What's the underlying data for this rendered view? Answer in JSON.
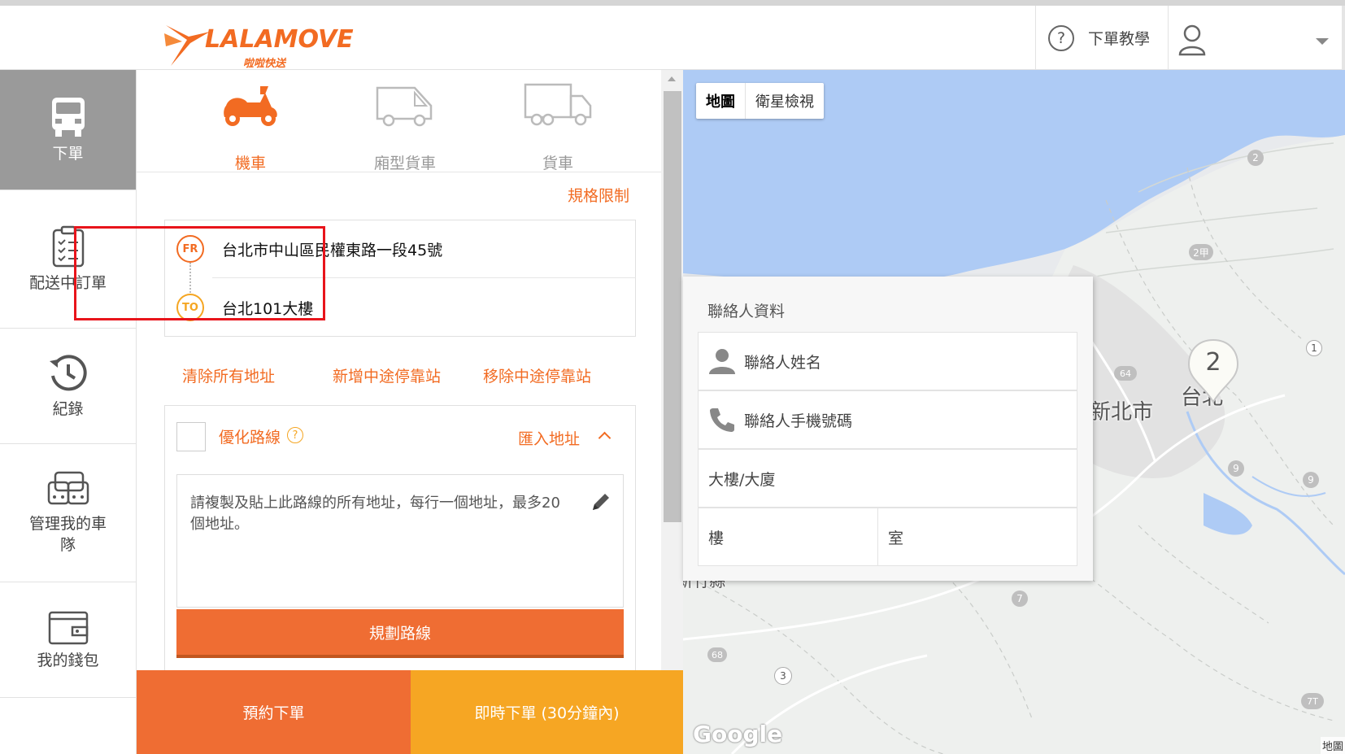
{
  "header": {
    "logo_text": "LALAMOVE",
    "logo_subtext": "啦啦快送",
    "help_icon_glyph": "?",
    "help_label": "下單教學",
    "brand_color": "#f26b22"
  },
  "nav": {
    "items": [
      {
        "label": "下單",
        "icon": "truck-front-icon",
        "active": true
      },
      {
        "label": "配送中訂單",
        "icon": "clipboard-icon",
        "active": false
      },
      {
        "label": "紀錄",
        "icon": "history-icon",
        "active": false
      },
      {
        "label": "管理我的車隊",
        "icon": "fleet-icon",
        "active": false
      },
      {
        "label": "我的錢包",
        "icon": "wallet-icon",
        "active": false
      }
    ]
  },
  "vehicles": [
    {
      "label": "機車",
      "icon": "scooter-icon",
      "active": true
    },
    {
      "label": "廂型貨車",
      "icon": "van-icon",
      "active": false
    },
    {
      "label": "貨車",
      "icon": "truck-icon",
      "active": false
    }
  ],
  "order": {
    "spec_link": "規格限制",
    "from_badge": "FR",
    "to_badge": "TO",
    "from_address": "台北市中山區民權東路一段45號",
    "to_address": "台北101大樓",
    "clear_all": "清除所有地址",
    "add_stop": "新增中途停靠站",
    "remove_stop": "移除中途停靠站",
    "optimize_label": "優化路線",
    "optimize_help_glyph": "?",
    "import_label": "匯入地址",
    "import_placeholder": "請複製及貼上此路線的所有地址，每行一個地址，最多20個地址。",
    "plan_button": "規劃路線"
  },
  "bottom": {
    "schedule_button": "預約下單",
    "instant_button": "即時下單 (30分鐘內)",
    "schedule_color": "#ef6d33",
    "instant_color": "#f6a623"
  },
  "map": {
    "toggle_map": "地圖",
    "toggle_satellite": "衛星檢視",
    "label_taipei": "台北",
    "label_newtaipei": "新北市",
    "label_hsinchu": "新竹縣",
    "cluster_count": "2",
    "google_mark": "Google",
    "corner_text": "地圖",
    "road_badges": [
      "2",
      "2甲",
      "1",
      "64",
      "9",
      "9",
      "7",
      "68",
      "3",
      "7T",
      "2"
    ]
  },
  "contact": {
    "title": "聯絡人資料",
    "name_placeholder": "聯絡人姓名",
    "phone_placeholder": "聯絡人手機號碼",
    "building_placeholder": "大樓/大廈",
    "floor_placeholder": "樓",
    "room_placeholder": "室"
  }
}
